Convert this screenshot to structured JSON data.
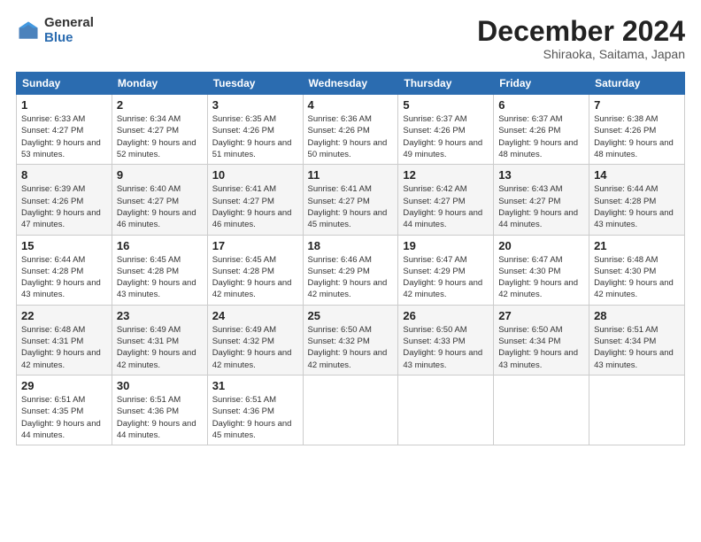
{
  "header": {
    "logo_general": "General",
    "logo_blue": "Blue",
    "month_title": "December 2024",
    "subtitle": "Shiraoka, Saitama, Japan"
  },
  "weekdays": [
    "Sunday",
    "Monday",
    "Tuesday",
    "Wednesday",
    "Thursday",
    "Friday",
    "Saturday"
  ],
  "weeks": [
    [
      {
        "day": "1",
        "sunrise": "6:33 AM",
        "sunset": "4:27 PM",
        "daylight": "9 hours and 53 minutes."
      },
      {
        "day": "2",
        "sunrise": "6:34 AM",
        "sunset": "4:27 PM",
        "daylight": "9 hours and 52 minutes."
      },
      {
        "day": "3",
        "sunrise": "6:35 AM",
        "sunset": "4:26 PM",
        "daylight": "9 hours and 51 minutes."
      },
      {
        "day": "4",
        "sunrise": "6:36 AM",
        "sunset": "4:26 PM",
        "daylight": "9 hours and 50 minutes."
      },
      {
        "day": "5",
        "sunrise": "6:37 AM",
        "sunset": "4:26 PM",
        "daylight": "9 hours and 49 minutes."
      },
      {
        "day": "6",
        "sunrise": "6:37 AM",
        "sunset": "4:26 PM",
        "daylight": "9 hours and 48 minutes."
      },
      {
        "day": "7",
        "sunrise": "6:38 AM",
        "sunset": "4:26 PM",
        "daylight": "9 hours and 48 minutes."
      }
    ],
    [
      {
        "day": "8",
        "sunrise": "6:39 AM",
        "sunset": "4:26 PM",
        "daylight": "9 hours and 47 minutes."
      },
      {
        "day": "9",
        "sunrise": "6:40 AM",
        "sunset": "4:27 PM",
        "daylight": "9 hours and 46 minutes."
      },
      {
        "day": "10",
        "sunrise": "6:41 AM",
        "sunset": "4:27 PM",
        "daylight": "9 hours and 46 minutes."
      },
      {
        "day": "11",
        "sunrise": "6:41 AM",
        "sunset": "4:27 PM",
        "daylight": "9 hours and 45 minutes."
      },
      {
        "day": "12",
        "sunrise": "6:42 AM",
        "sunset": "4:27 PM",
        "daylight": "9 hours and 44 minutes."
      },
      {
        "day": "13",
        "sunrise": "6:43 AM",
        "sunset": "4:27 PM",
        "daylight": "9 hours and 44 minutes."
      },
      {
        "day": "14",
        "sunrise": "6:44 AM",
        "sunset": "4:28 PM",
        "daylight": "9 hours and 43 minutes."
      }
    ],
    [
      {
        "day": "15",
        "sunrise": "6:44 AM",
        "sunset": "4:28 PM",
        "daylight": "9 hours and 43 minutes."
      },
      {
        "day": "16",
        "sunrise": "6:45 AM",
        "sunset": "4:28 PM",
        "daylight": "9 hours and 43 minutes."
      },
      {
        "day": "17",
        "sunrise": "6:45 AM",
        "sunset": "4:28 PM",
        "daylight": "9 hours and 42 minutes."
      },
      {
        "day": "18",
        "sunrise": "6:46 AM",
        "sunset": "4:29 PM",
        "daylight": "9 hours and 42 minutes."
      },
      {
        "day": "19",
        "sunrise": "6:47 AM",
        "sunset": "4:29 PM",
        "daylight": "9 hours and 42 minutes."
      },
      {
        "day": "20",
        "sunrise": "6:47 AM",
        "sunset": "4:30 PM",
        "daylight": "9 hours and 42 minutes."
      },
      {
        "day": "21",
        "sunrise": "6:48 AM",
        "sunset": "4:30 PM",
        "daylight": "9 hours and 42 minutes."
      }
    ],
    [
      {
        "day": "22",
        "sunrise": "6:48 AM",
        "sunset": "4:31 PM",
        "daylight": "9 hours and 42 minutes."
      },
      {
        "day": "23",
        "sunrise": "6:49 AM",
        "sunset": "4:31 PM",
        "daylight": "9 hours and 42 minutes."
      },
      {
        "day": "24",
        "sunrise": "6:49 AM",
        "sunset": "4:32 PM",
        "daylight": "9 hours and 42 minutes."
      },
      {
        "day": "25",
        "sunrise": "6:50 AM",
        "sunset": "4:32 PM",
        "daylight": "9 hours and 42 minutes."
      },
      {
        "day": "26",
        "sunrise": "6:50 AM",
        "sunset": "4:33 PM",
        "daylight": "9 hours and 43 minutes."
      },
      {
        "day": "27",
        "sunrise": "6:50 AM",
        "sunset": "4:34 PM",
        "daylight": "9 hours and 43 minutes."
      },
      {
        "day": "28",
        "sunrise": "6:51 AM",
        "sunset": "4:34 PM",
        "daylight": "9 hours and 43 minutes."
      }
    ],
    [
      {
        "day": "29",
        "sunrise": "6:51 AM",
        "sunset": "4:35 PM",
        "daylight": "9 hours and 44 minutes."
      },
      {
        "day": "30",
        "sunrise": "6:51 AM",
        "sunset": "4:36 PM",
        "daylight": "9 hours and 44 minutes."
      },
      {
        "day": "31",
        "sunrise": "6:51 AM",
        "sunset": "4:36 PM",
        "daylight": "9 hours and 45 minutes."
      },
      null,
      null,
      null,
      null
    ]
  ],
  "labels": {
    "sunrise": "Sunrise:",
    "sunset": "Sunset:",
    "daylight": "Daylight:"
  }
}
